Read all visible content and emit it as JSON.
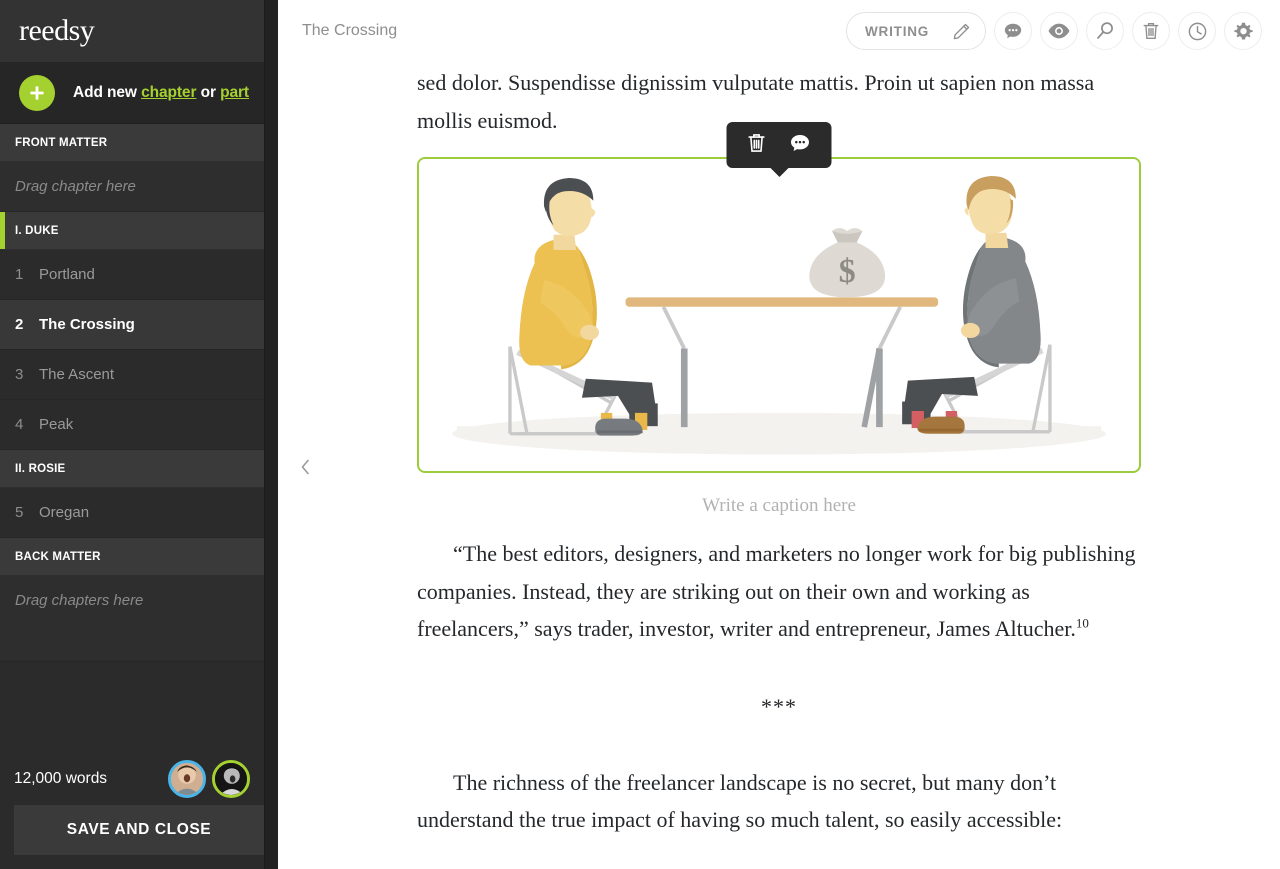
{
  "sidebar": {
    "logo": "reedsy",
    "add_new": {
      "prefix": "Add new ",
      "chapter_link": "chapter",
      "middle": " or ",
      "part_link": "part",
      "plus_icon": "plus-icon"
    },
    "sections": [
      {
        "type": "header",
        "label": "FRONT MATTER",
        "accent": false
      },
      {
        "type": "dropzone",
        "label": "Drag chapter here"
      },
      {
        "type": "header",
        "label": "I. DUKE",
        "accent": true
      },
      {
        "type": "chapter",
        "number": "1",
        "title": "Portland",
        "active": false
      },
      {
        "type": "chapter",
        "number": "2",
        "title": "The Crossing",
        "active": true
      },
      {
        "type": "chapter",
        "number": "3",
        "title": "The Ascent",
        "active": false
      },
      {
        "type": "chapter",
        "number": "4",
        "title": "Peak",
        "active": false
      },
      {
        "type": "header",
        "label": "II. ROSIE",
        "accent": false
      },
      {
        "type": "chapter",
        "number": "5",
        "title": "Oregan",
        "active": false
      },
      {
        "type": "header",
        "label": "BACK MATTER",
        "accent": false
      },
      {
        "type": "dropzone",
        "label": "Drag chapters here"
      }
    ],
    "footer": {
      "word_count": "12,000 words",
      "save_button": "SAVE AND CLOSE",
      "avatars": [
        {
          "name": "collaborator-avatar-1",
          "ring_color": "#49b5e8"
        },
        {
          "name": "collaborator-avatar-2",
          "ring_color": "#a5d130"
        }
      ]
    }
  },
  "topbar": {
    "doc_title": "The Crossing",
    "mode_pill": {
      "label": "WRITING",
      "icon": "pencil-icon"
    },
    "buttons": [
      {
        "name": "comments-button",
        "icon": "comment-bubble-icon"
      },
      {
        "name": "preview-button",
        "icon": "eye-icon"
      },
      {
        "name": "search-button",
        "icon": "magnifier-icon"
      },
      {
        "name": "delete-button",
        "icon": "trash-icon"
      },
      {
        "name": "history-button",
        "icon": "clock-icon"
      },
      {
        "name": "settings-button",
        "icon": "gear-icon"
      }
    ],
    "collapse_icon": "chevron-left-icon"
  },
  "document": {
    "paragraph_top": "sed dolor. Suspendisse dignissim vulputate mattis. Proin ut sapien non massa mollis euismod.",
    "image_block": {
      "selected": true,
      "border_color": "#9ccb3b",
      "caption_placeholder": "Write a caption here",
      "alt": "Two men seated at a table with a money bag between them",
      "floating_toolbar": [
        {
          "name": "image-delete-button",
          "icon": "trash-icon"
        },
        {
          "name": "image-comment-button",
          "icon": "comment-bubble-icon"
        }
      ]
    },
    "quote_paragraph": "“The best editors, designers, and marketers no longer work for big publishing companies. Instead, they are striking out on their own and working as freelancers,” says trader, investor, writer and entrepreneur, James Altucher.",
    "footnote_marker": "10",
    "scene_break": "***",
    "paragraph_bottom": "The richness of the freelancer landscape is no secret, but many don’t understand the true impact of having so much talent, so easily accessible:"
  },
  "colors": {
    "accent_green": "#a5d130",
    "sidebar_bg": "#2b2b2b",
    "sidebar_header_bg": "#3a3a3a",
    "avatar_blue": "#49b5e8"
  }
}
